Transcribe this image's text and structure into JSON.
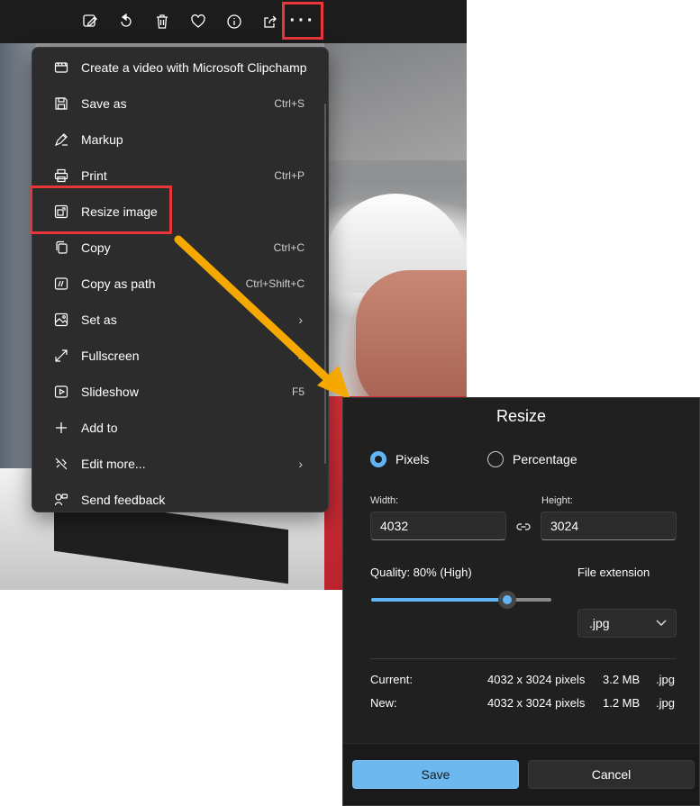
{
  "toolbar": {
    "icons": [
      "edit-icon",
      "rotate-icon",
      "delete-icon",
      "favorite-icon",
      "info-icon",
      "share-icon",
      "more-icon"
    ],
    "more_label": "···"
  },
  "menu": {
    "items": [
      {
        "label": "Create a video with Microsoft Clipchamp",
        "shortcut": "",
        "icon": "clipchamp-icon"
      },
      {
        "label": "Save as",
        "shortcut": "Ctrl+S",
        "icon": "save-icon"
      },
      {
        "label": "Markup",
        "shortcut": "",
        "icon": "markup-icon"
      },
      {
        "label": "Print",
        "shortcut": "Ctrl+P",
        "icon": "print-icon"
      },
      {
        "label": "Resize image",
        "shortcut": "",
        "icon": "resize-icon"
      },
      {
        "label": "Copy",
        "shortcut": "Ctrl+C",
        "icon": "copy-icon"
      },
      {
        "label": "Copy as path",
        "shortcut": "Ctrl+Shift+C",
        "icon": "copy-path-icon"
      },
      {
        "label": "Set as",
        "shortcut": "",
        "icon": "set-as-icon",
        "chevron": "›"
      },
      {
        "label": "Fullscreen",
        "shortcut": "F",
        "icon": "fullscreen-icon"
      },
      {
        "label": "Slideshow",
        "shortcut": "F5",
        "icon": "slideshow-icon"
      },
      {
        "label": "Add to",
        "shortcut": "",
        "icon": "add-icon"
      },
      {
        "label": "Edit more...",
        "shortcut": "",
        "icon": "edit-more-icon",
        "chevron": "›"
      },
      {
        "label": "Send feedback",
        "shortcut": "",
        "icon": "feedback-icon"
      }
    ]
  },
  "dialog": {
    "title": "Resize",
    "mode_pixels": "Pixels",
    "mode_percentage": "Percentage",
    "selected_mode": "Pixels",
    "width_label": "Width:",
    "width_value": "4032",
    "height_label": "Height:",
    "height_value": "3024",
    "quality_label": "Quality: 80% (High)",
    "quality_value": 0.8,
    "ext_label": "File extension",
    "ext_value": ".jpg",
    "current_label": "Current:",
    "current_dims": "4032 x 3024 pixels",
    "current_size": "3.2 MB",
    "current_ext": ".jpg",
    "new_label": "New:",
    "new_dims": "4032 x 3024 pixels",
    "new_size": "1.2 MB",
    "new_ext": ".jpg",
    "save_label": "Save",
    "cancel_label": "Cancel"
  },
  "colors": {
    "highlight": "#e8363b",
    "arrow": "#f5a800",
    "accent": "#60b5f5",
    "save_button": "#6db8ef"
  }
}
